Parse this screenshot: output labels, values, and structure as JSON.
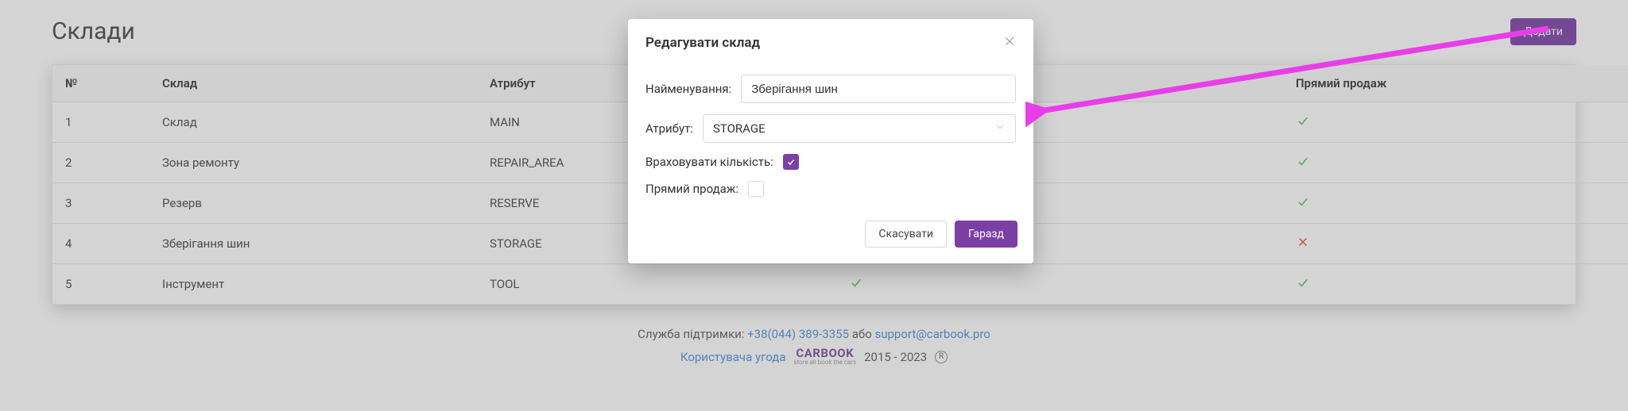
{
  "page": {
    "title": "Склади"
  },
  "buttons": {
    "add": "Додати",
    "cancel": "Скасувати",
    "ok": "Гаразд"
  },
  "table": {
    "headers": {
      "num": "№",
      "name": "Склад",
      "attr": "Атрибут",
      "qty": "Враховувати кількість",
      "direct": "Прямий продаж"
    },
    "rows": [
      {
        "num": "1",
        "name": "Склад",
        "attr": "MAIN",
        "qty": true,
        "direct": true
      },
      {
        "num": "2",
        "name": "Зона ремонту",
        "attr": "REPAIR_AREA",
        "qty": true,
        "direct": true
      },
      {
        "num": "3",
        "name": "Резерв",
        "attr": "RESERVE",
        "qty": true,
        "direct": true
      },
      {
        "num": "4",
        "name": "Зберігання шин",
        "attr": "STORAGE",
        "qty": true,
        "direct": false
      },
      {
        "num": "5",
        "name": "Інструмент",
        "attr": "TOOL",
        "qty": true,
        "direct": true
      }
    ]
  },
  "modal": {
    "title": "Редагувати склад",
    "labels": {
      "name": "Найменування:",
      "attr": "Атрибут:",
      "qty": "Враховувати кількість:",
      "direct": "Прямий продаж:"
    },
    "values": {
      "name": "Зберігання шин",
      "attr": "STORAGE",
      "qty": true,
      "direct": false
    }
  },
  "footer": {
    "support_label": "Служба підтримки: ",
    "phone": "+38(044) 389-3355",
    "or": " або ",
    "email": "support@carbook.pro",
    "agreement": "Користувача угода",
    "brand": "CARBOOK",
    "brand_sub": "store all book the cars",
    "years": "2015 - 2023",
    "reg": "R"
  },
  "icons": {
    "check": "check-icon",
    "cross": "cross-icon",
    "edit": "edit-icon",
    "trash": "trash-icon",
    "close": "close-icon",
    "chevron": "chevron-down-icon"
  }
}
